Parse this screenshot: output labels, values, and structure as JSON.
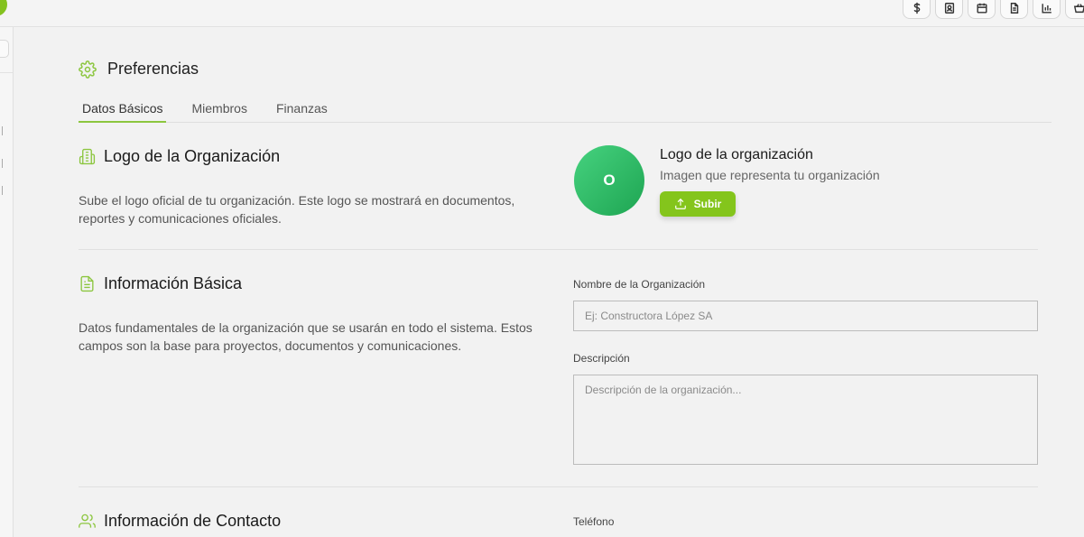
{
  "top_icons": [
    "dollar-icon",
    "contact-icon",
    "calendar-icon",
    "document-icon",
    "chart-icon",
    "basket-icon"
  ],
  "page": {
    "title": "Preferencias"
  },
  "tabs": [
    {
      "label": "Datos Básicos",
      "active": true
    },
    {
      "label": "Miembros",
      "active": false
    },
    {
      "label": "Finanzas",
      "active": false
    }
  ],
  "logo_section": {
    "title": "Logo de la Organización",
    "description": "Sube el logo oficial de tu organización. Este logo se mostrará en documentos, reportes y comunicaciones oficiales.",
    "avatar_initial": "O",
    "logo_label": "Logo de la organización",
    "logo_sub": "Imagen que representa tu organización",
    "upload_label": "Subir"
  },
  "basic_section": {
    "title": "Información Básica",
    "description": "Datos fundamentales de la organización que se usarán en todo el sistema. Estos campos son la base para proyectos, documentos y comunicaciones.",
    "name_label": "Nombre de la Organización",
    "name_value": "",
    "name_placeholder": "Ej: Constructora López SA",
    "desc_label": "Descripción",
    "desc_value": "",
    "desc_placeholder": "Descripción de la organización..."
  },
  "contact_section": {
    "title": "Información de Contacto",
    "phone_label": "Teléfono"
  },
  "colors": {
    "accent": "#8cc63f",
    "button": "#84c51c",
    "avatar": "#2fbf68"
  }
}
